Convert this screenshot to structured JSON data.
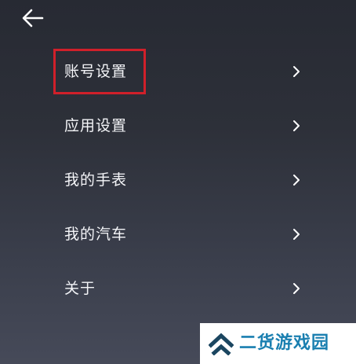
{
  "header": {
    "back_icon": "arrow-left-icon"
  },
  "menu": {
    "items": [
      {
        "label": "账号设置",
        "icon": "chevron-right-icon"
      },
      {
        "label": "应用设置",
        "icon": "chevron-right-icon"
      },
      {
        "label": "我的手表",
        "icon": "chevron-right-icon"
      },
      {
        "label": "我的汽车",
        "icon": "chevron-right-icon"
      },
      {
        "label": "关于",
        "icon": "chevron-right-icon"
      }
    ]
  },
  "annotation": {
    "highlight_color": "#d0202a"
  },
  "watermark": {
    "text": "二货游戏园",
    "text_color": "#1a7fb0",
    "logo_color": "#1b4660",
    "logo_icon": "double-chevron-up-icon"
  }
}
